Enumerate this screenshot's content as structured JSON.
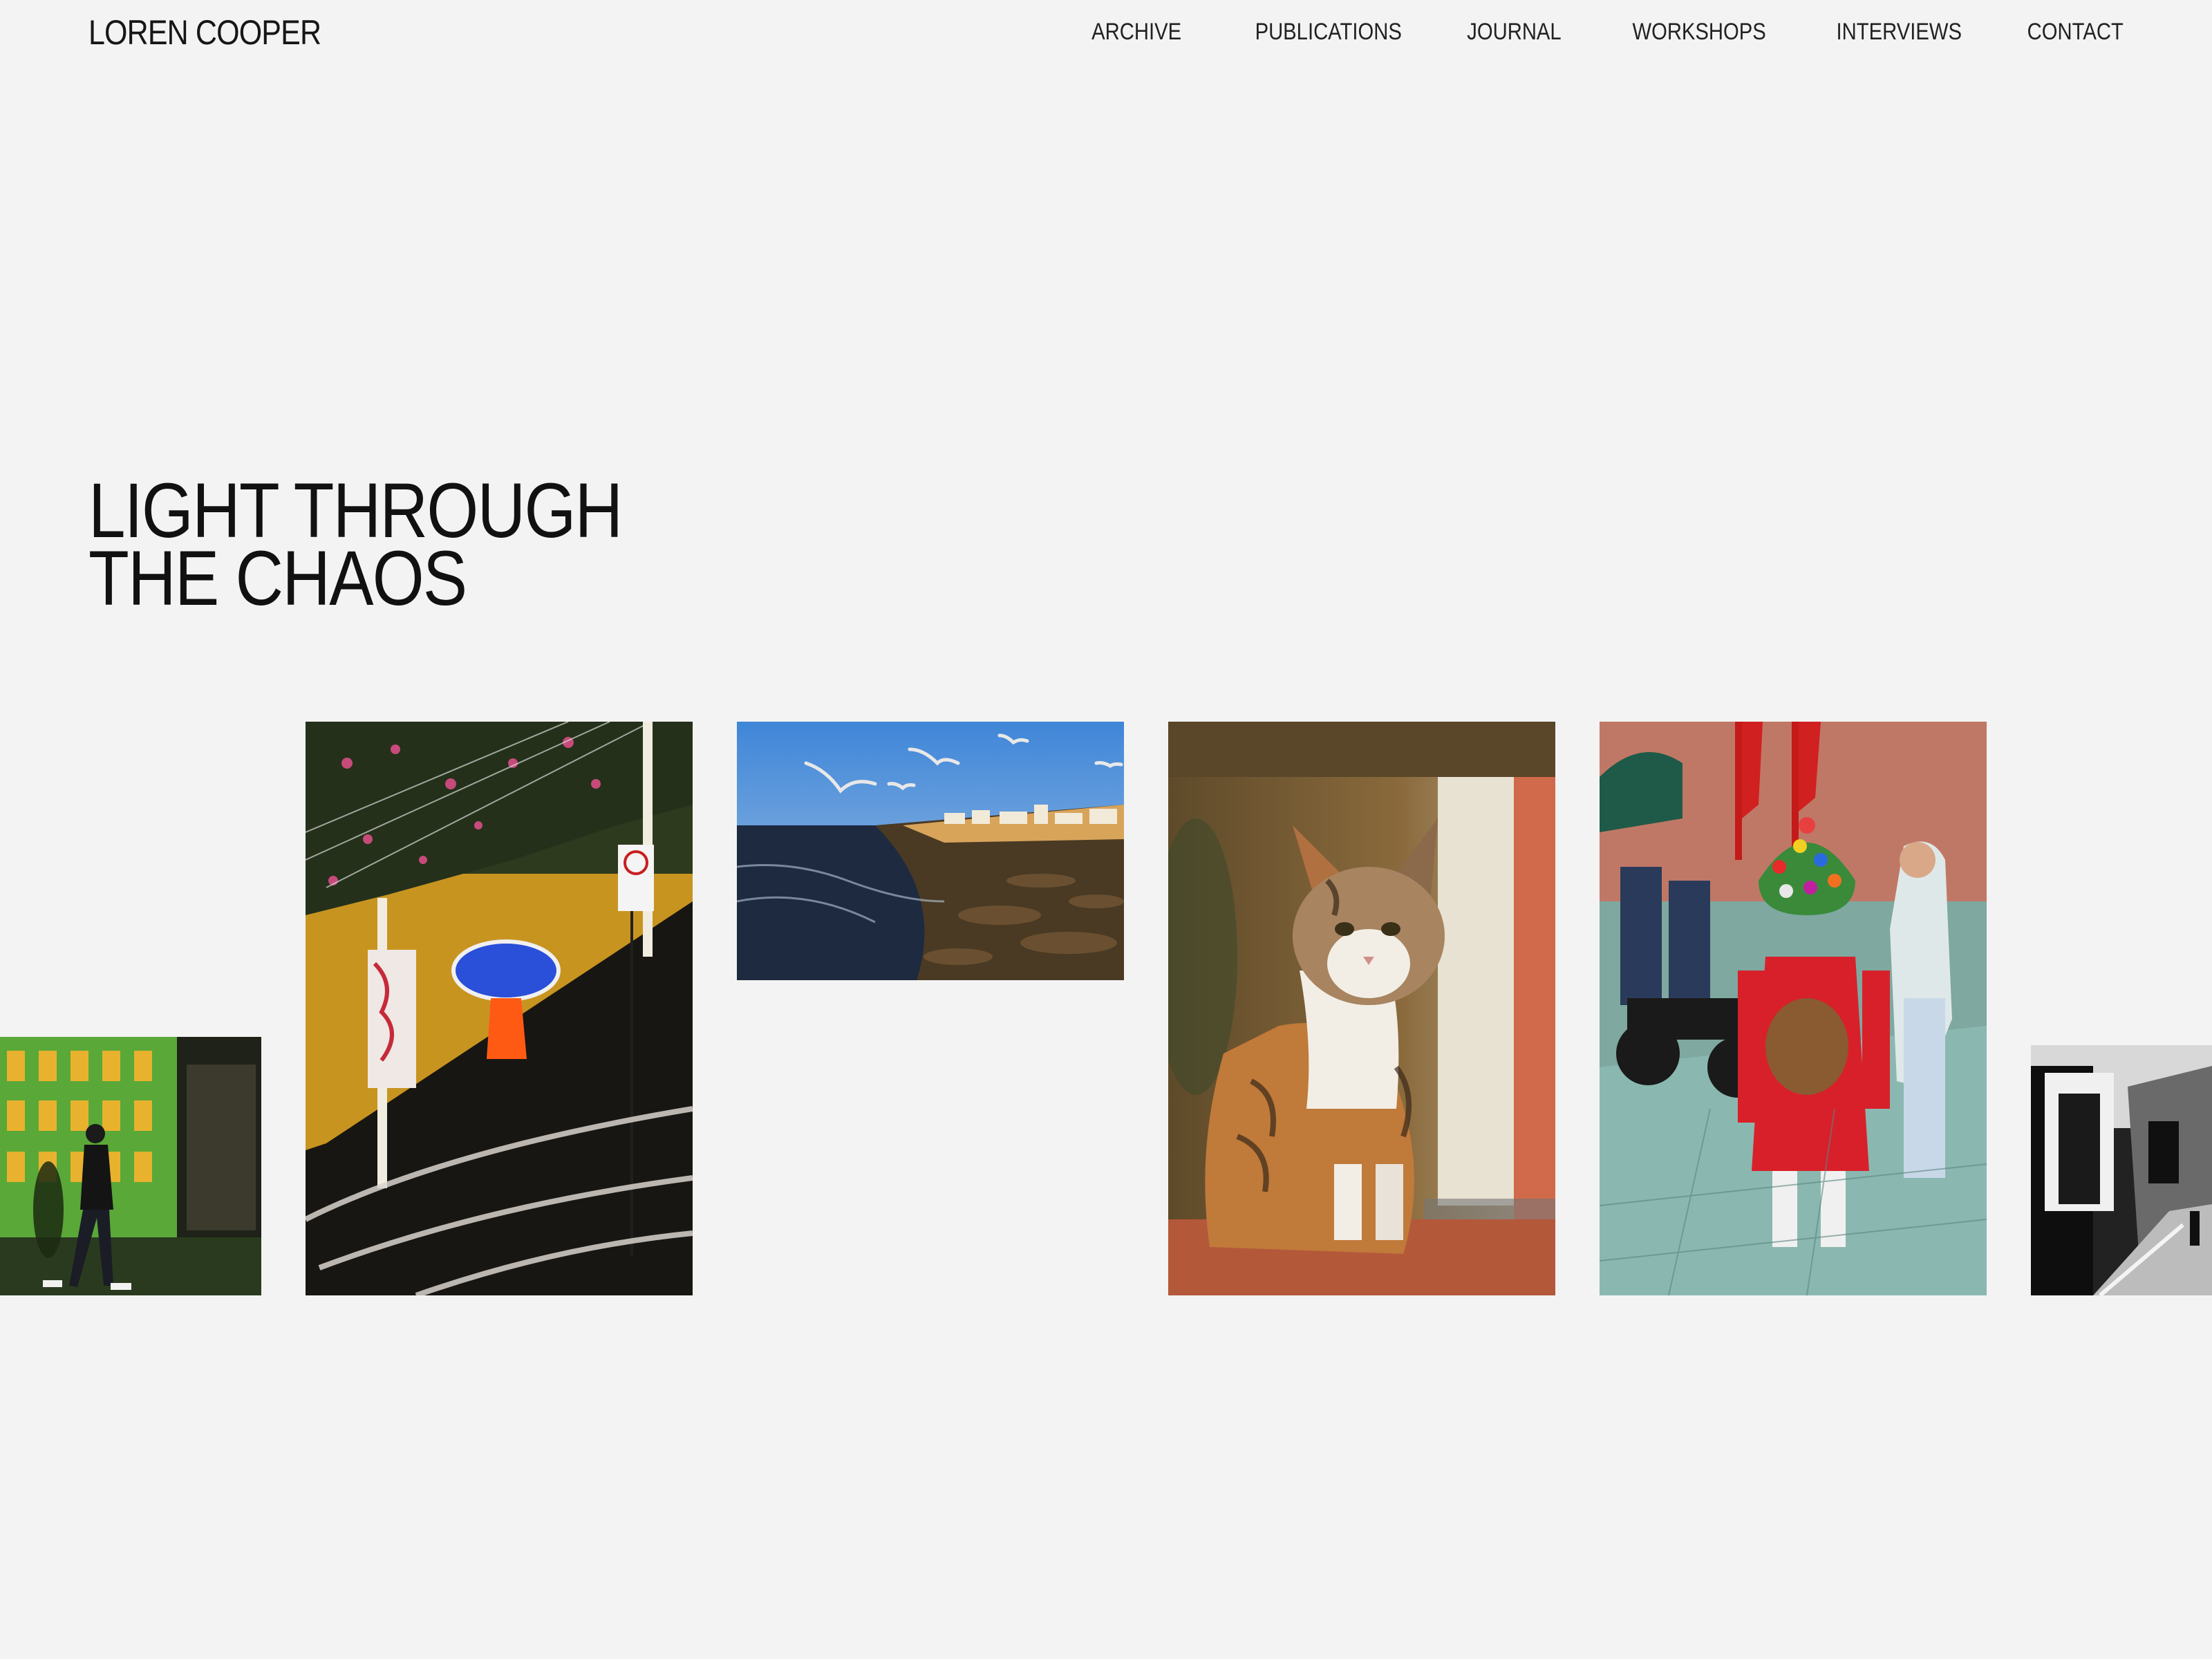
{
  "site": {
    "logo": "LOREN COOPER"
  },
  "nav": {
    "items": [
      "ARCHIVE",
      "PUBLICATIONS",
      "JOURNAL",
      "WORKSHOPS",
      "INTERVIEWS",
      "CONTACT"
    ]
  },
  "hero": {
    "title_line_1": "LIGHT THROUGH",
    "title_line_2": "THE CHAOS"
  },
  "colors": {
    "background": "#f3f3f3",
    "text": "#161616"
  }
}
